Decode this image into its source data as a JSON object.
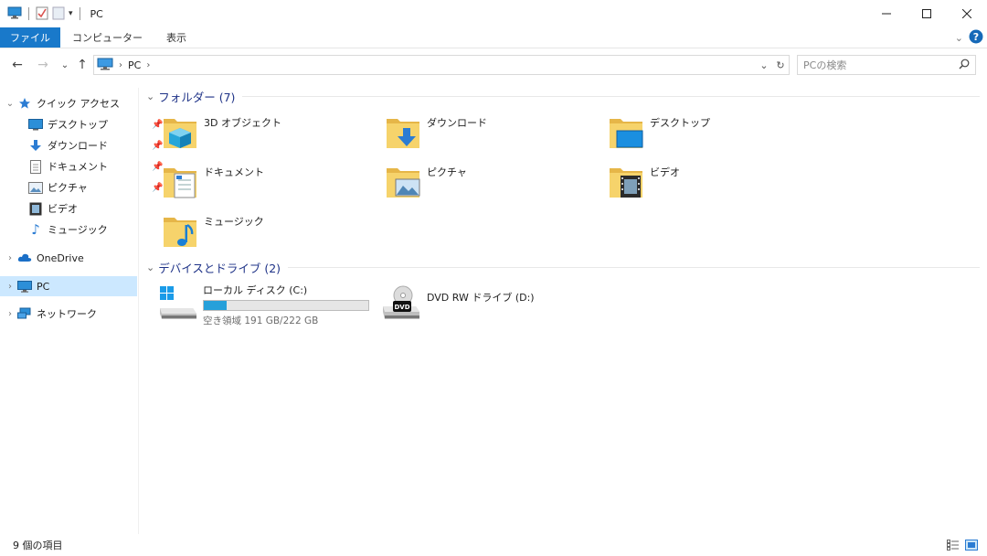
{
  "window": {
    "title": "PC",
    "minimize_icon": "minimize-icon",
    "maximize_icon": "maximize-icon",
    "close_icon": "close-icon"
  },
  "ribbon": {
    "tabs": [
      "ファイル",
      "コンピューター",
      "表示"
    ],
    "accent_color": "#1979ca"
  },
  "address": {
    "crumb": "PC",
    "search_placeholder": "PCの検索"
  },
  "sidebar": {
    "quick_access": "クイック アクセス",
    "items": [
      {
        "label": "デスクトップ",
        "icon": "desktop-icon",
        "pinned": true
      },
      {
        "label": "ダウンロード",
        "icon": "download-icon",
        "pinned": true
      },
      {
        "label": "ドキュメント",
        "icon": "document-icon",
        "pinned": true
      },
      {
        "label": "ピクチャ",
        "icon": "picture-icon",
        "pinned": true
      },
      {
        "label": "ビデオ",
        "icon": "video-icon",
        "pinned": false
      },
      {
        "label": "ミュージック",
        "icon": "music-icon",
        "pinned": false
      }
    ],
    "onedrive": "OneDrive",
    "pc": "PC",
    "network": "ネットワーク"
  },
  "content": {
    "folders_header": "フォルダー (7)",
    "folders": [
      {
        "label": "3D オブジェクト",
        "icon": "3d-objects-folder-icon"
      },
      {
        "label": "ダウンロード",
        "icon": "downloads-folder-icon"
      },
      {
        "label": "デスクトップ",
        "icon": "desktop-folder-icon"
      },
      {
        "label": "ドキュメント",
        "icon": "documents-folder-icon"
      },
      {
        "label": "ピクチャ",
        "icon": "pictures-folder-icon"
      },
      {
        "label": "ビデオ",
        "icon": "videos-folder-icon"
      },
      {
        "label": "ミュージック",
        "icon": "music-folder-icon"
      }
    ],
    "drives_header": "デバイスとドライブ (2)",
    "drives": [
      {
        "label": "ローカル ディスク (C:)",
        "free": "空き領域 191 GB/222 GB",
        "used_fraction": 0.14,
        "icon": "local-disk-icon"
      },
      {
        "label": "DVD RW ドライブ (D:)",
        "icon": "dvd-drive-icon"
      }
    ]
  },
  "status": {
    "item_count": "9 個の項目"
  }
}
